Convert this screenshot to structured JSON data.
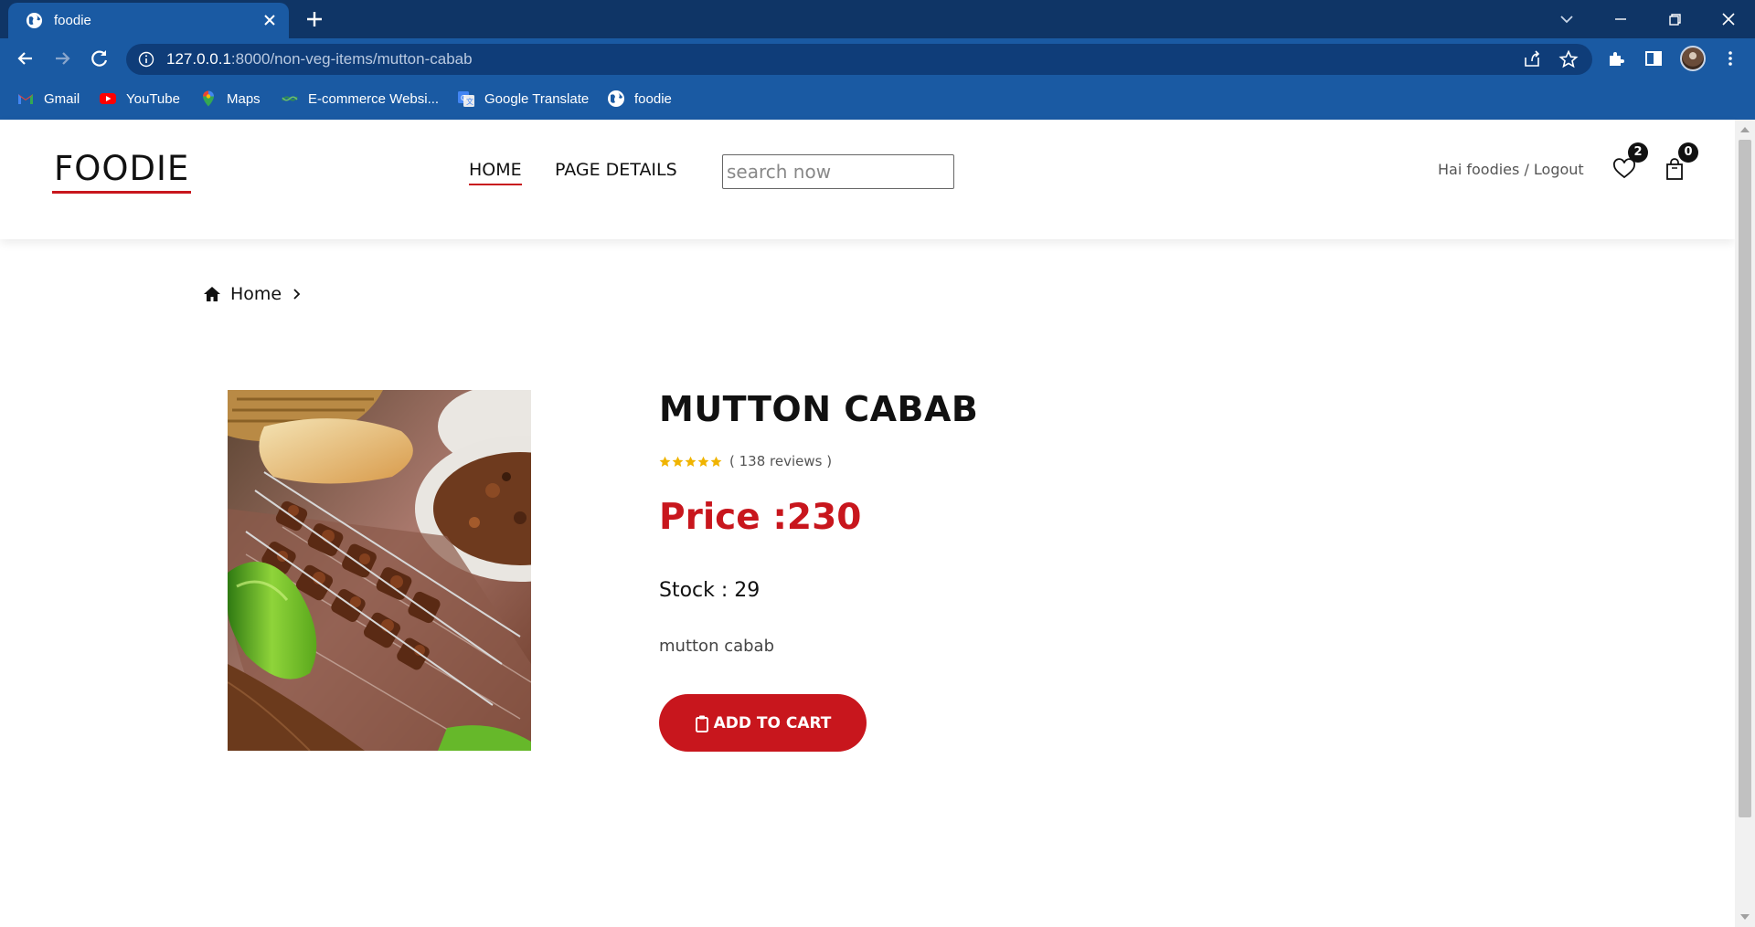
{
  "browser": {
    "tab_title": "foodie",
    "url_host": "127.0.0.1",
    "url_rest": ":8000/non-veg-items/mutton-cabab",
    "bookmarks": [
      {
        "label": "Gmail",
        "icon": "gmail-icon"
      },
      {
        "label": "YouTube",
        "icon": "youtube-icon"
      },
      {
        "label": "Maps",
        "icon": "maps-icon"
      },
      {
        "label": "E-commerce Websi...",
        "icon": "ecommerce-icon"
      },
      {
        "label": "Google Translate",
        "icon": "translate-icon"
      },
      {
        "label": "foodie",
        "icon": "globe-icon"
      }
    ]
  },
  "site": {
    "logo": "FOODIE",
    "nav": [
      {
        "label": "HOME",
        "active": true
      },
      {
        "label": "PAGE DETAILS",
        "active": false
      }
    ],
    "search_placeholder": "search now",
    "greeting": "Hai foodies / Logout",
    "wishlist_count": "2",
    "cart_count": "0"
  },
  "breadcrumb": {
    "home_label": "Home"
  },
  "product": {
    "title": "MUTTON CABAB",
    "rating_stars": 5,
    "reviews": "( 138 reviews )",
    "price": "Price :230",
    "stock": "Stock : 29",
    "description": "mutton cabab",
    "add_to_cart": "ADD TO CART"
  },
  "colors": {
    "accent": "#c8161d",
    "browser_frame": "#0f3566",
    "browser_toolbar": "#1a5aa3",
    "star": "#f0b400"
  }
}
